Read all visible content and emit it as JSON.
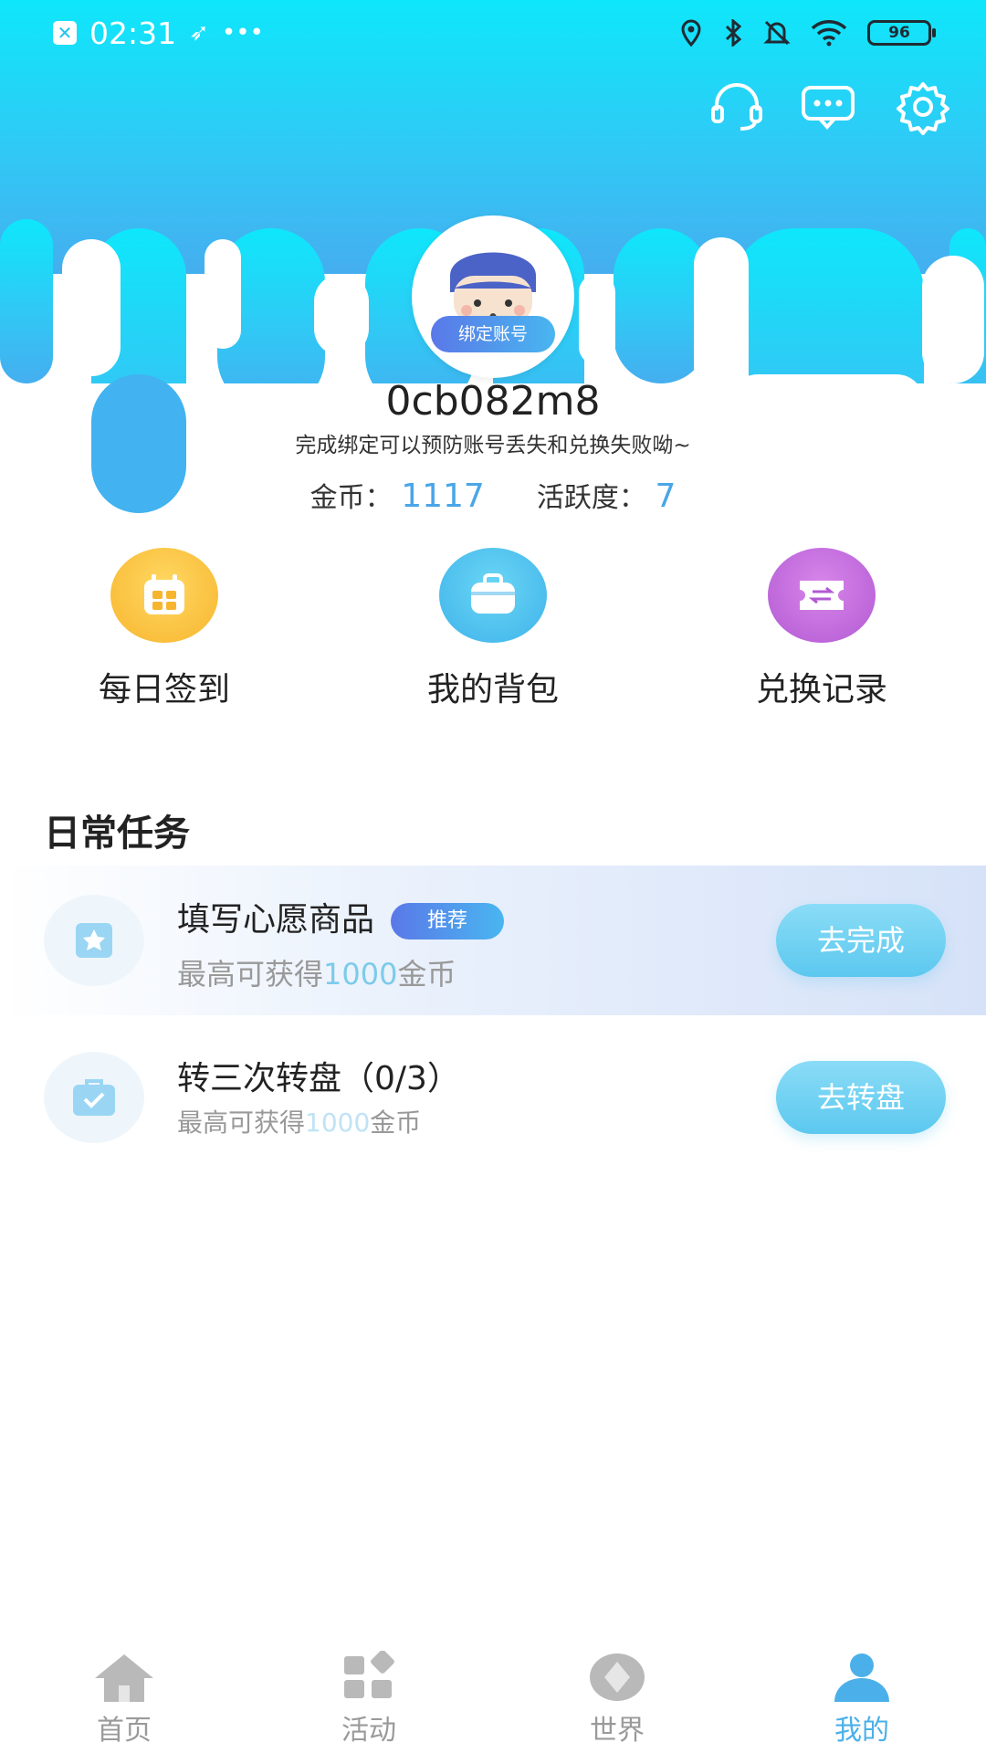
{
  "status_bar": {
    "time": "02:31",
    "extra": "•••",
    "battery": "96"
  },
  "header": {
    "support_icon": "headset-icon",
    "message_icon": "chat-icon",
    "settings_icon": "gear-icon"
  },
  "profile": {
    "bind_tag": "绑定账号",
    "username": "0cb082m8",
    "bind_hint": "完成绑定可以预防账号丢失和兑换失败呦~",
    "coins_label": "金币：",
    "coins_value": "1117",
    "activity_label": "活跃度：",
    "activity_value": "7"
  },
  "quick_actions": [
    {
      "label": "每日签到",
      "icon": "calendar-icon",
      "color": "#f7b52e"
    },
    {
      "label": "我的背包",
      "icon": "backpack-icon",
      "color": "#3fb3ea"
    },
    {
      "label": "兑换记录",
      "icon": "ticket-icon",
      "color": "#b25ad3"
    }
  ],
  "daily_tasks": {
    "title": "日常任务",
    "items": [
      {
        "title": "填写心愿商品",
        "badge": "推荐",
        "sub_prefix": "最高可获得",
        "sub_value": "1000",
        "sub_suffix": "金币",
        "button": "去完成",
        "icon": "star-card-icon"
      },
      {
        "title": "转三次转盘（0/3）",
        "sub_prefix": "最高可获得",
        "sub_value": "1000",
        "sub_suffix": "金币",
        "button": "去转盘",
        "icon": "check-box-icon"
      }
    ]
  },
  "tabs": [
    {
      "label": "首页",
      "icon": "home-icon"
    },
    {
      "label": "活动",
      "icon": "grid-icon"
    },
    {
      "label": "世界",
      "icon": "world-icon"
    },
    {
      "label": "我的",
      "icon": "user-icon",
      "active": true
    }
  ]
}
